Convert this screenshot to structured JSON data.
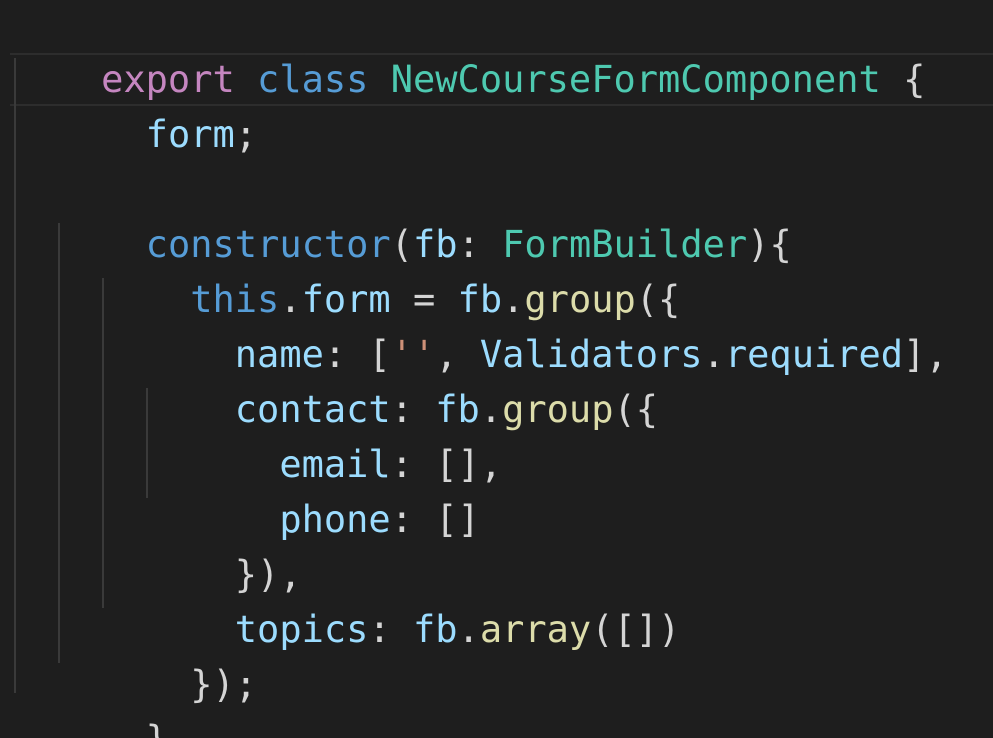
{
  "editor": {
    "line1": {
      "export": "export",
      "class": "class",
      "name": "NewCourseFormComponent",
      "brace": " {"
    },
    "line2": {
      "indent": "  ",
      "field": "form",
      "semi": ";"
    },
    "line3": {
      "text": ""
    },
    "line4": {
      "indent": "  ",
      "ctor": "constructor",
      "open": "(",
      "param": "fb",
      "colon": ": ",
      "ptype": "FormBuilder",
      "close": "){"
    },
    "line5": {
      "indent": "    ",
      "this": "this",
      "dot": ".",
      "field": "form",
      "eq": " = ",
      "obj": "fb",
      "dot2": ".",
      "method": "group",
      "open": "({"
    },
    "line6": {
      "indent": "      ",
      "key": "name",
      "colon": ": [",
      "str": "''",
      "comma": ", ",
      "cls": "Validators",
      "dot": ".",
      "member": "required",
      "end": "],"
    },
    "line7": {
      "indent": "      ",
      "key": "contact",
      "colon": ": ",
      "obj": "fb",
      "dot": ".",
      "method": "group",
      "open": "({"
    },
    "line8": {
      "indent": "        ",
      "key": "email",
      "rest": ": [],"
    },
    "line9": {
      "indent": "        ",
      "key": "phone",
      "rest": ": []"
    },
    "line10": {
      "indent": "      ",
      "text": "}),"
    },
    "line11": {
      "indent": "      ",
      "key": "topics",
      "colon": ": ",
      "obj": "fb",
      "dot": ".",
      "method": "array",
      "rest": "([])"
    },
    "line12": {
      "indent": "    ",
      "text": "});"
    },
    "line13": {
      "indent": "  ",
      "text": "}"
    }
  },
  "colors": {
    "background": "#1e1e1e",
    "keyword_control": "#c586c0",
    "keyword_storage": "#569cd6",
    "type": "#4ec9b0",
    "variable": "#9cdcfe",
    "function": "#dcdcaa",
    "string": "#ce9178",
    "text": "#d4d4d4"
  }
}
